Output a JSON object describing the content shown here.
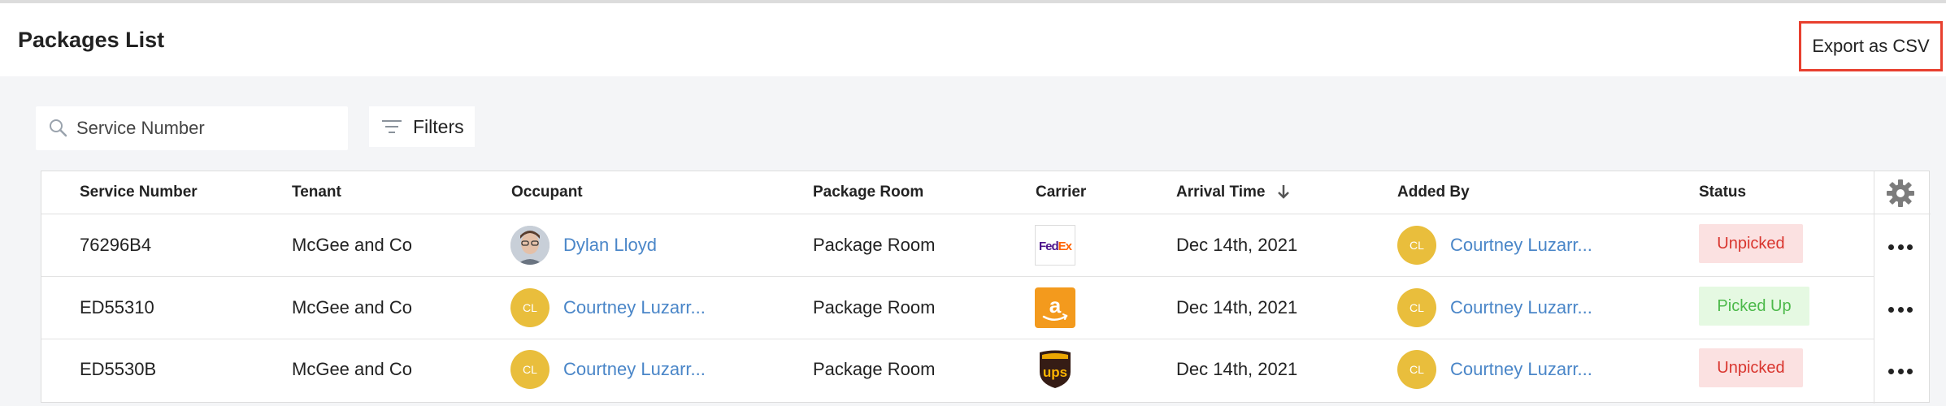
{
  "header": {
    "title": "Packages List",
    "export_label": "Export as CSV"
  },
  "toolbar": {
    "search_placeholder": "Service Number",
    "filters_label": "Filters"
  },
  "table": {
    "columns": [
      "Service Number",
      "Tenant",
      "Occupant",
      "Package Room",
      "Carrier",
      "Arrival Time",
      "Added By",
      "Status"
    ],
    "sorted_column": "Arrival Time",
    "sort_direction": "descending",
    "rows": [
      {
        "service_number": "76296B4",
        "tenant": "McGee and Co",
        "occupant": {
          "name": "Dylan Lloyd",
          "avatar": "photo"
        },
        "package_room": "Package Room",
        "carrier": "fedex",
        "carrier_label": "FedEx",
        "arrival_time": "Dec 14th, 2021",
        "added_by": {
          "name": "Courtney Luzarr...",
          "initials": "CL"
        },
        "status": "Unpicked"
      },
      {
        "service_number": "ED55310",
        "tenant": "McGee and Co",
        "occupant": {
          "name": "Courtney Luzarr...",
          "initials": "CL"
        },
        "package_room": "Package Room",
        "carrier": "amazon",
        "arrival_time": "Dec 14th, 2021",
        "added_by": {
          "name": "Courtney Luzarr...",
          "initials": "CL"
        },
        "status": "Picked Up"
      },
      {
        "service_number": "ED5530B",
        "tenant": "McGee and Co",
        "occupant": {
          "name": "Courtney Luzarr...",
          "initials": "CL"
        },
        "package_room": "Package Room",
        "carrier": "ups",
        "carrier_label": "ups",
        "arrival_time": "Dec 14th, 2021",
        "added_by": {
          "name": "Courtney Luzarr...",
          "initials": "CL"
        },
        "status": "Unpicked"
      }
    ]
  },
  "colors": {
    "accent_link": "#4a86c8",
    "export_border": "#e8402f",
    "avatar_bg": "#e9be3c",
    "unpicked_bg": "#fbe1e1",
    "unpicked_text": "#d9352e",
    "picked_bg": "#e5f9e2",
    "picked_text": "#4cb94a"
  }
}
